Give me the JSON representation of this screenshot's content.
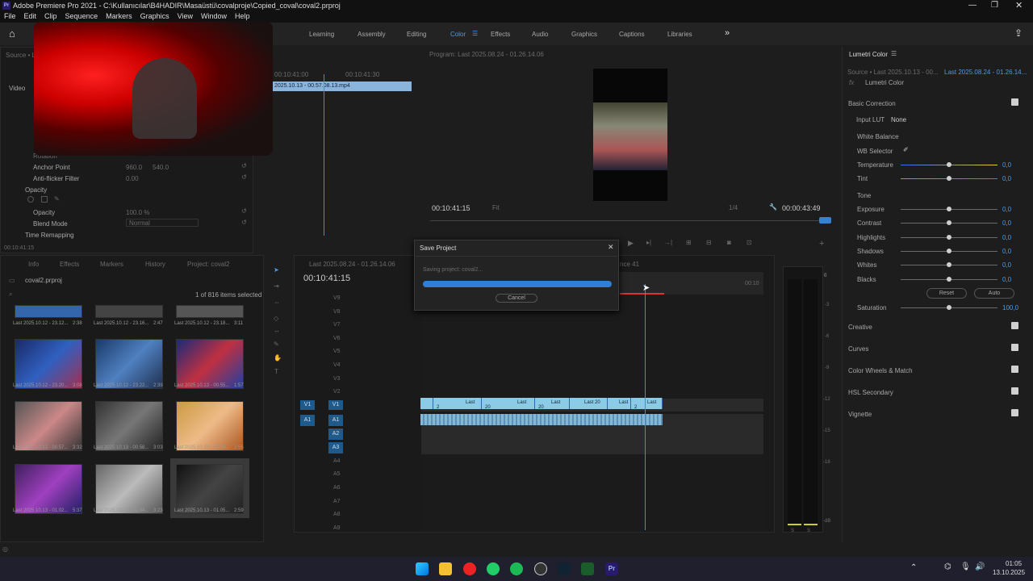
{
  "window_title": "Adobe Premiere Pro 2021 - C:\\Kullanıcılar\\B4HADIR\\Masaüstü\\covalproje\\Copied_coval\\coval2.prproj",
  "menu": [
    "File",
    "Edit",
    "Clip",
    "Sequence",
    "Markers",
    "Graphics",
    "View",
    "Window",
    "Help"
  ],
  "workspace_tabs": [
    "Learning",
    "Assembly",
    "Editing",
    "Color",
    "Effects",
    "Audio",
    "Graphics",
    "Captions",
    "Libraries"
  ],
  "active_tab": "Color",
  "source_panel": {
    "label": "Source • L",
    "video": "Video",
    "clip_name": "2025.10.13 - 00.57.08.13.mp4",
    "tc_left": "00:10:41:00",
    "tc_right": "00:10:41:30",
    "timecode": "00:10:41:15"
  },
  "effect_controls": {
    "rotation": "Rotation",
    "anchor_point": "Anchor Point",
    "anchor_vals": [
      "960.0",
      "540.0"
    ],
    "anti_flicker": "Anti-flicker Filter",
    "anti_flicker_val": "0.00",
    "opacity_section": "Opacity",
    "opacity": "Opacity",
    "opacity_val": "100.0 %",
    "blend_mode": "Blend Mode",
    "blend_val": "Normal",
    "time_remap": "Time Remapping"
  },
  "program": {
    "title": "Program: Last 2025.08.24 - 01.26.14.06",
    "tc_left": "00:10:41:15",
    "fit": "Fit",
    "quality": "1/4",
    "tc_right": "00:00:43:49"
  },
  "project_panel": {
    "tabs": [
      "Info",
      "Effects",
      "Markers",
      "History",
      "Project: coval2"
    ],
    "project_file": "coval2.prproj",
    "items_selected": "1 of 816 items selected",
    "items": [
      {
        "name": "Last 2025.10.12 - 23.12...",
        "dur": "2:38"
      },
      {
        "name": "Last 2025.10.12 - 23.16...",
        "dur": "2:47"
      },
      {
        "name": "Last 2025.10.12 - 23.18...",
        "dur": "3:11"
      },
      {
        "name": "Last 2025.10.12 - 23.20...",
        "dur": "3:08"
      },
      {
        "name": "Last 2025.10.12 - 23.22...",
        "dur": "2:39"
      },
      {
        "name": "Last 2025.10.13 - 00.55...",
        "dur": "1:57"
      },
      {
        "name": "Last 2025.10.13 - 00.57...",
        "dur": "3:32"
      },
      {
        "name": "Last 2025.10.13 - 00.58...",
        "dur": "3:03"
      },
      {
        "name": "Last 2025.10.13 - 00.59...",
        "dur": "2:55"
      },
      {
        "name": "Last 2025.10.13 - 01.02...",
        "dur": "5:37"
      },
      {
        "name": "Last 2025.10.13 - 01.04...",
        "dur": "3:23"
      },
      {
        "name": "Last 2025.10.13 - 01.05...",
        "dur": "2:59"
      }
    ]
  },
  "timeline": {
    "tab": "Last 2025.08.24 - 01.26.14.06",
    "tab2": "nce 41",
    "timecode": "00:10:41:15",
    "ruler_end": "00:10",
    "video_tracks": [
      "V9",
      "V8",
      "V7",
      "V6",
      "V5",
      "V4",
      "V3",
      "V2",
      "V1"
    ],
    "audio_tracks": [
      "A1",
      "A2",
      "A3",
      "A4",
      "A5",
      "A6",
      "A7",
      "A8",
      "A9"
    ],
    "src_v1": "V1",
    "src_a1": "A1",
    "clips": [
      "Last 2",
      "Last 20",
      "Last 20",
      "Last 20",
      "Last",
      "Last 2"
    ]
  },
  "dialog": {
    "title": "Save Project",
    "message": "Saving project: coval2...",
    "progress": 1.0,
    "cancel": "Cancel"
  },
  "meter_scale": [
    "0",
    "-3",
    "-6",
    "-9",
    "-12",
    "-15",
    "-18",
    "-dB"
  ],
  "meter_bottom": [
    "S",
    "S"
  ],
  "lumetri": {
    "title": "Lumetri Color",
    "source": "Source • Last 2025.10.13 - 00...",
    "sequence": "Last 2025.08.24 - 01.26.14...",
    "fx": "Lumetri Color",
    "basic_correction": "Basic Correction",
    "input_lut": "Input LUT",
    "input_lut_val": "None",
    "white_balance": "White Balance",
    "wb_selector": "WB Selector",
    "temperature": {
      "label": "Temperature",
      "value": "0,0"
    },
    "tint": {
      "label": "Tint",
      "value": "0,0"
    },
    "tone": "Tone",
    "tone_rows": [
      {
        "label": "Exposure",
        "value": "0,0"
      },
      {
        "label": "Contrast",
        "value": "0,0"
      },
      {
        "label": "Highlights",
        "value": "0,0"
      },
      {
        "label": "Shadows",
        "value": "0,0"
      },
      {
        "label": "Whites",
        "value": "0,0"
      },
      {
        "label": "Blacks",
        "value": "0,0"
      }
    ],
    "reset": "Reset",
    "auto": "Auto",
    "saturation": {
      "label": "Saturation",
      "value": "100,0"
    },
    "sections": [
      "Creative",
      "Curves",
      "Color Wheels & Match",
      "HSL Secondary",
      "Vignette"
    ]
  },
  "clock": {
    "time": "01:05",
    "date": "13.10.2025"
  },
  "colors": {
    "accent": "#4a9be8",
    "clip": "#8ccbe6",
    "playhead": "#4a88d8",
    "progress": "#2f7fd8"
  }
}
